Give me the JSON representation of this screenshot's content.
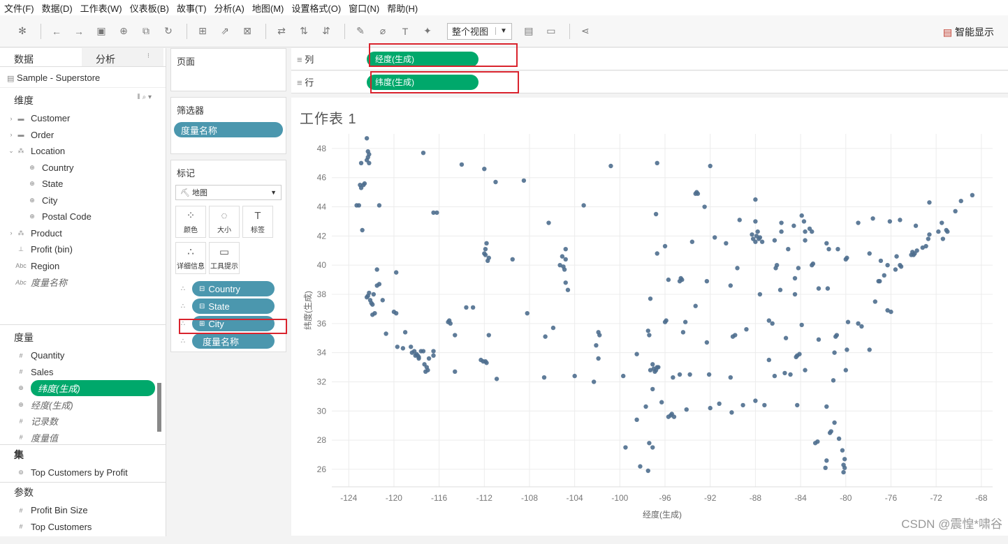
{
  "menu": [
    "文件(F)",
    "数据(D)",
    "工作表(W)",
    "仪表板(B)",
    "故事(T)",
    "分析(A)",
    "地图(M)",
    "设置格式(O)",
    "窗口(N)",
    "帮助(H)"
  ],
  "toolbar": {
    "view_select": "整个视图",
    "smart_show": "智能显示"
  },
  "left": {
    "tab_data": "数据",
    "tab_analysis": "分析",
    "datasource": "Sample - Superstore",
    "dimensions_title": "维度",
    "dimensions": [
      {
        "label": "Customer",
        "icon": "folder-icon",
        "caret": "›",
        "indent": 0
      },
      {
        "label": "Order",
        "icon": "folder-icon",
        "caret": "›",
        "indent": 0
      },
      {
        "label": "Location",
        "icon": "hierarchy-icon",
        "caret": "⌄",
        "indent": 0
      },
      {
        "label": "Country",
        "icon": "globe-icon",
        "caret": "",
        "indent": 1
      },
      {
        "label": "State",
        "icon": "globe-icon",
        "caret": "",
        "indent": 1
      },
      {
        "label": "City",
        "icon": "globe-icon",
        "caret": "",
        "indent": 1
      },
      {
        "label": "Postal Code",
        "icon": "globe-icon",
        "caret": "",
        "indent": 1
      },
      {
        "label": "Product",
        "icon": "hierarchy-icon",
        "caret": "›",
        "indent": 0
      },
      {
        "label": "Profit (bin)",
        "icon": "bin-icon",
        "caret": "",
        "indent": 0
      },
      {
        "label": "Region",
        "icon": "abc-icon",
        "caret": "",
        "indent": 0
      },
      {
        "label": "度量名称",
        "icon": "abc-icon",
        "caret": "",
        "indent": 0,
        "italic": true
      }
    ],
    "measures_title": "度量",
    "measures": [
      {
        "label": "Quantity",
        "icon": "number-icon"
      },
      {
        "label": "Sales",
        "icon": "number-icon"
      },
      {
        "label": "纬度(生成)",
        "icon": "globe-icon",
        "highlight": true
      },
      {
        "label": "经度(生成)",
        "icon": "globe-icon",
        "italic": true
      },
      {
        "label": "记录数",
        "icon": "number-icon",
        "italic": true
      },
      {
        "label": "度量值",
        "icon": "number-icon",
        "italic": true
      }
    ],
    "sets_title": "集",
    "sets": [
      {
        "label": "Top Customers by Profit",
        "icon": "set-icon"
      }
    ],
    "params_title": "参数",
    "params": [
      {
        "label": "Profit Bin Size",
        "icon": "number-icon"
      },
      {
        "label": "Top Customers",
        "icon": "number-icon"
      }
    ]
  },
  "mid": {
    "pages_title": "页面",
    "filters_title": "筛选器",
    "filter_pill": "度量名称",
    "marks_title": "标记",
    "mark_type": "地图",
    "mark_buttons": [
      {
        "label": "颜色",
        "icon": "color-icon",
        "glyph": "⁘"
      },
      {
        "label": "大小",
        "icon": "size-icon",
        "glyph": "◌"
      },
      {
        "label": "标签",
        "icon": "label-icon",
        "glyph": "T"
      },
      {
        "label": "详细信息",
        "icon": "detail-icon",
        "glyph": "∴"
      },
      {
        "label": "工具提示",
        "icon": "tooltip-icon",
        "glyph": "▭"
      }
    ],
    "mark_pills": [
      {
        "label": "Country",
        "prefix": "⊟"
      },
      {
        "label": "State",
        "prefix": "⊟"
      },
      {
        "label": "City",
        "prefix": "⊞"
      },
      {
        "label": "度量名称",
        "prefix": ""
      }
    ]
  },
  "shelves": {
    "columns_label": "列",
    "columns_pill": "经度(生成)",
    "rows_label": "行",
    "rows_pill": "纬度(生成)"
  },
  "worksheet": {
    "title": "工作表 1",
    "watermark": "CSDN @震惶*啸谷"
  },
  "chart_data": {
    "type": "scatter",
    "title": "",
    "xlabel": "经度(生成)",
    "ylabel": "纬度(生成)",
    "xlim": [
      -125.5,
      -67
    ],
    "ylim": [
      24.8,
      49
    ],
    "xticks": [
      -124,
      -120,
      -116,
      -112,
      -108,
      -104,
      -100,
      -96,
      -92,
      -88,
      -84,
      -80,
      -76,
      -72,
      -68
    ],
    "yticks": [
      26,
      28,
      30,
      32,
      34,
      36,
      38,
      40,
      42,
      44,
      46,
      48
    ],
    "grid": true,
    "point_color": "#4e6e8e",
    "points": [
      [
        -122.4,
        48.7
      ],
      [
        -122.3,
        47.8
      ],
      [
        -122.2,
        47.6
      ],
      [
        -122.3,
        47.4
      ],
      [
        -122.4,
        47.2
      ],
      [
        -122.2,
        47.0
      ],
      [
        -122.9,
        47.0
      ],
      [
        -122.6,
        45.6
      ],
      [
        -122.7,
        45.5
      ],
      [
        -123.0,
        45.5
      ],
      [
        -122.9,
        45.3
      ],
      [
        -123.1,
        44.1
      ],
      [
        -123.3,
        44.1
      ],
      [
        -122.8,
        42.4
      ],
      [
        -121.3,
        44.1
      ],
      [
        -117.4,
        47.7
      ],
      [
        -116.2,
        43.6
      ],
      [
        -116.5,
        43.6
      ],
      [
        -114.0,
        46.9
      ],
      [
        -112.0,
        46.6
      ],
      [
        -111.0,
        45.7
      ],
      [
        -108.5,
        45.8
      ],
      [
        -111.8,
        41.5
      ],
      [
        -111.9,
        41.1
      ],
      [
        -111.9,
        40.7
      ],
      [
        -111.7,
        40.3
      ],
      [
        -111.6,
        40.5
      ],
      [
        -112.0,
        40.8
      ],
      [
        -113.0,
        37.1
      ],
      [
        -114.6,
        35.2
      ],
      [
        -115.1,
        36.2
      ],
      [
        -115.2,
        36.1
      ],
      [
        -115.0,
        36.0
      ],
      [
        -119.8,
        39.5
      ],
      [
        -122.4,
        37.8
      ],
      [
        -122.3,
        37.9
      ],
      [
        -122.0,
        37.4
      ],
      [
        -121.9,
        37.3
      ],
      [
        -122.1,
        37.6
      ],
      [
        -121.5,
        38.6
      ],
      [
        -121.3,
        38.7
      ],
      [
        -121.8,
        38.0
      ],
      [
        -122.2,
        38.1
      ],
      [
        -121.0,
        37.6
      ],
      [
        -120.0,
        36.8
      ],
      [
        -119.8,
        36.7
      ],
      [
        -119.0,
        35.4
      ],
      [
        -120.7,
        35.3
      ],
      [
        -119.2,
        34.3
      ],
      [
        -118.2,
        34.1
      ],
      [
        -118.4,
        34.0
      ],
      [
        -118.0,
        33.9
      ],
      [
        -117.9,
        33.8
      ],
      [
        -117.8,
        33.7
      ],
      [
        -117.2,
        32.7
      ],
      [
        -117.1,
        33.0
      ],
      [
        -117.3,
        33.2
      ],
      [
        -117.4,
        34.1
      ],
      [
        -116.5,
        33.8
      ],
      [
        -117.0,
        32.8
      ],
      [
        -117.6,
        34.1
      ],
      [
        -118.1,
        33.8
      ],
      [
        -116.9,
        33.6
      ],
      [
        -116.5,
        34.1
      ],
      [
        -118.5,
        34.4
      ],
      [
        -121.9,
        36.6
      ],
      [
        -121.7,
        36.7
      ],
      [
        -119.7,
        34.4
      ],
      [
        -121.5,
        39.7
      ],
      [
        -117.8,
        33.6
      ],
      [
        -112.1,
        33.4
      ],
      [
        -111.9,
        33.4
      ],
      [
        -111.8,
        33.3
      ],
      [
        -112.3,
        33.5
      ],
      [
        -110.9,
        32.2
      ],
      [
        -111.6,
        35.2
      ],
      [
        -114.6,
        32.7
      ],
      [
        -113.6,
        37.1
      ],
      [
        -109.5,
        40.4
      ],
      [
        -104.9,
        39.7
      ],
      [
        -105.0,
        39.9
      ],
      [
        -104.8,
        38.8
      ],
      [
        -105.1,
        40.6
      ],
      [
        -104.8,
        40.4
      ],
      [
        -105.3,
        40.0
      ],
      [
        -104.6,
        38.3
      ],
      [
        -106.6,
        35.1
      ],
      [
        -106.7,
        32.3
      ],
      [
        -105.9,
        35.7
      ],
      [
        -108.2,
        36.7
      ],
      [
        -104.0,
        32.4
      ],
      [
        -102.1,
        34.5
      ],
      [
        -101.9,
        33.6
      ],
      [
        -101.8,
        35.2
      ],
      [
        -102.3,
        32.0
      ],
      [
        -103.2,
        44.1
      ],
      [
        -106.3,
        42.9
      ],
      [
        -104.8,
        41.1
      ],
      [
        -100.8,
        46.8
      ],
      [
        -98.5,
        29.4
      ],
      [
        -97.7,
        30.3
      ],
      [
        -97.3,
        32.8
      ],
      [
        -97.0,
        32.9
      ],
      [
        -96.8,
        32.8
      ],
      [
        -96.7,
        33.0
      ],
      [
        -97.1,
        33.2
      ],
      [
        -96.6,
        33.0
      ],
      [
        -96.9,
        32.7
      ],
      [
        -95.4,
        29.8
      ],
      [
        -95.5,
        29.7
      ],
      [
        -95.2,
        29.6
      ],
      [
        -95.7,
        29.6
      ],
      [
        -94.1,
        30.1
      ],
      [
        -97.4,
        27.8
      ],
      [
        -98.2,
        26.2
      ],
      [
        -97.5,
        25.9
      ],
      [
        -97.1,
        27.5
      ],
      [
        -99.5,
        27.5
      ],
      [
        -96.3,
        30.6
      ],
      [
        -97.1,
        31.5
      ],
      [
        -94.7,
        32.5
      ],
      [
        -95.3,
        32.3
      ],
      [
        -101.9,
        35.4
      ],
      [
        -99.7,
        32.4
      ],
      [
        -98.5,
        33.9
      ],
      [
        -97.5,
        35.5
      ],
      [
        -97.4,
        35.2
      ],
      [
        -96.0,
        36.1
      ],
      [
        -95.9,
        36.2
      ],
      [
        -97.3,
        37.7
      ],
      [
        -95.7,
        39.0
      ],
      [
        -94.6,
        39.1
      ],
      [
        -94.7,
        38.9
      ],
      [
        -96.7,
        40.8
      ],
      [
        -96.0,
        41.3
      ],
      [
        -93.6,
        41.6
      ],
      [
        -93.3,
        44.9
      ],
      [
        -93.2,
        45.0
      ],
      [
        -92.5,
        44.0
      ],
      [
        -96.8,
        43.5
      ],
      [
        -96.7,
        47.0
      ],
      [
        -93.1,
        44.9
      ],
      [
        -92.0,
        46.8
      ],
      [
        -90.2,
        38.6
      ],
      [
        -94.5,
        39.0
      ],
      [
        -92.3,
        38.9
      ],
      [
        -93.3,
        37.2
      ],
      [
        -91.6,
        41.9
      ],
      [
        -90.6,
        41.5
      ],
      [
        -89.6,
        39.8
      ],
      [
        -89.4,
        43.1
      ],
      [
        -88.0,
        43.0
      ],
      [
        -88.0,
        44.5
      ],
      [
        -87.6,
        41.9
      ],
      [
        -87.7,
        41.8
      ],
      [
        -87.9,
        42.0
      ],
      [
        -88.2,
        41.8
      ],
      [
        -88.3,
        42.1
      ],
      [
        -87.8,
        42.3
      ],
      [
        -88.0,
        41.6
      ],
      [
        -87.4,
        41.6
      ],
      [
        -86.2,
        39.8
      ],
      [
        -86.1,
        40.0
      ],
      [
        -87.6,
        38.0
      ],
      [
        -85.1,
        41.1
      ],
      [
        -86.3,
        41.7
      ],
      [
        -85.7,
        42.3
      ],
      [
        -85.7,
        42.9
      ],
      [
        -84.6,
        42.7
      ],
      [
        -83.0,
        42.3
      ],
      [
        -83.2,
        42.5
      ],
      [
        -83.6,
        42.3
      ],
      [
        -83.7,
        43.0
      ],
      [
        -83.9,
        43.4
      ],
      [
        -84.5,
        39.1
      ],
      [
        -84.2,
        39.8
      ],
      [
        -83.0,
        40.0
      ],
      [
        -82.9,
        40.1
      ],
      [
        -81.7,
        41.5
      ],
      [
        -81.5,
        41.1
      ],
      [
        -80.7,
        41.1
      ],
      [
        -83.6,
        41.7
      ],
      [
        -82.4,
        38.4
      ],
      [
        -81.6,
        38.4
      ],
      [
        -84.5,
        38.0
      ],
      [
        -85.8,
        38.3
      ],
      [
        -86.8,
        36.2
      ],
      [
        -86.5,
        36.0
      ],
      [
        -85.3,
        35.0
      ],
      [
        -83.9,
        35.9
      ],
      [
        -90.0,
        35.1
      ],
      [
        -89.8,
        35.2
      ],
      [
        -88.8,
        35.6
      ],
      [
        -92.3,
        34.7
      ],
      [
        -94.2,
        36.1
      ],
      [
        -94.4,
        35.4
      ],
      [
        -90.2,
        32.3
      ],
      [
        -89.1,
        30.4
      ],
      [
        -91.2,
        30.5
      ],
      [
        -90.1,
        29.9
      ],
      [
        -93.8,
        32.5
      ],
      [
        -92.1,
        32.5
      ],
      [
        -92.0,
        30.2
      ],
      [
        -86.8,
        33.5
      ],
      [
        -86.3,
        32.4
      ],
      [
        -88.0,
        30.7
      ],
      [
        -85.4,
        32.6
      ],
      [
        -84.4,
        33.7
      ],
      [
        -84.3,
        33.8
      ],
      [
        -84.1,
        33.9
      ],
      [
        -81.1,
        32.1
      ],
      [
        -83.6,
        32.8
      ],
      [
        -84.9,
        32.5
      ],
      [
        -82.5,
        27.9
      ],
      [
        -82.7,
        27.8
      ],
      [
        -81.7,
        26.6
      ],
      [
        -81.8,
        26.1
      ],
      [
        -80.2,
        25.8
      ],
      [
        -80.1,
        26.1
      ],
      [
        -80.2,
        26.3
      ],
      [
        -80.1,
        26.7
      ],
      [
        -80.3,
        27.3
      ],
      [
        -80.6,
        28.1
      ],
      [
        -81.4,
        28.5
      ],
      [
        -81.3,
        28.6
      ],
      [
        -81.7,
        30.3
      ],
      [
        -84.3,
        30.4
      ],
      [
        -87.2,
        30.4
      ],
      [
        -81.0,
        29.2
      ],
      [
        -80.8,
        35.2
      ],
      [
        -80.9,
        35.1
      ],
      [
        -79.8,
        36.1
      ],
      [
        -78.6,
        35.8
      ],
      [
        -78.9,
        36.0
      ],
      [
        -77.9,
        34.2
      ],
      [
        -81.0,
        34.0
      ],
      [
        -80.0,
        32.8
      ],
      [
        -82.4,
        34.9
      ],
      [
        -79.9,
        34.2
      ],
      [
        -77.4,
        37.5
      ],
      [
        -76.3,
        36.9
      ],
      [
        -76.0,
        36.8
      ],
      [
        -77.1,
        38.9
      ],
      [
        -77.0,
        38.9
      ],
      [
        -76.6,
        39.3
      ],
      [
        -75.6,
        39.7
      ],
      [
        -75.2,
        40.0
      ],
      [
        -75.1,
        39.9
      ],
      [
        -75.5,
        40.6
      ],
      [
        -76.3,
        40.0
      ],
      [
        -76.9,
        40.3
      ],
      [
        -77.9,
        40.8
      ],
      [
        -80.0,
        40.4
      ],
      [
        -79.9,
        40.5
      ],
      [
        -74.0,
        40.7
      ],
      [
        -73.9,
        40.8
      ],
      [
        -74.2,
        40.7
      ],
      [
        -74.1,
        40.9
      ],
      [
        -73.7,
        41.0
      ],
      [
        -73.8,
        42.7
      ],
      [
        -76.1,
        43.0
      ],
      [
        -77.6,
        43.2
      ],
      [
        -78.9,
        42.9
      ],
      [
        -75.2,
        43.1
      ],
      [
        -72.9,
        41.3
      ],
      [
        -72.7,
        41.8
      ],
      [
        -73.2,
        41.2
      ],
      [
        -71.4,
        41.8
      ],
      [
        -71.1,
        42.4
      ],
      [
        -71.0,
        42.3
      ],
      [
        -71.8,
        42.3
      ],
      [
        -72.6,
        42.1
      ],
      [
        -71.5,
        42.9
      ],
      [
        -70.3,
        43.7
      ],
      [
        -72.6,
        44.3
      ],
      [
        -69.8,
        44.4
      ],
      [
        -68.8,
        44.8
      ]
    ]
  }
}
